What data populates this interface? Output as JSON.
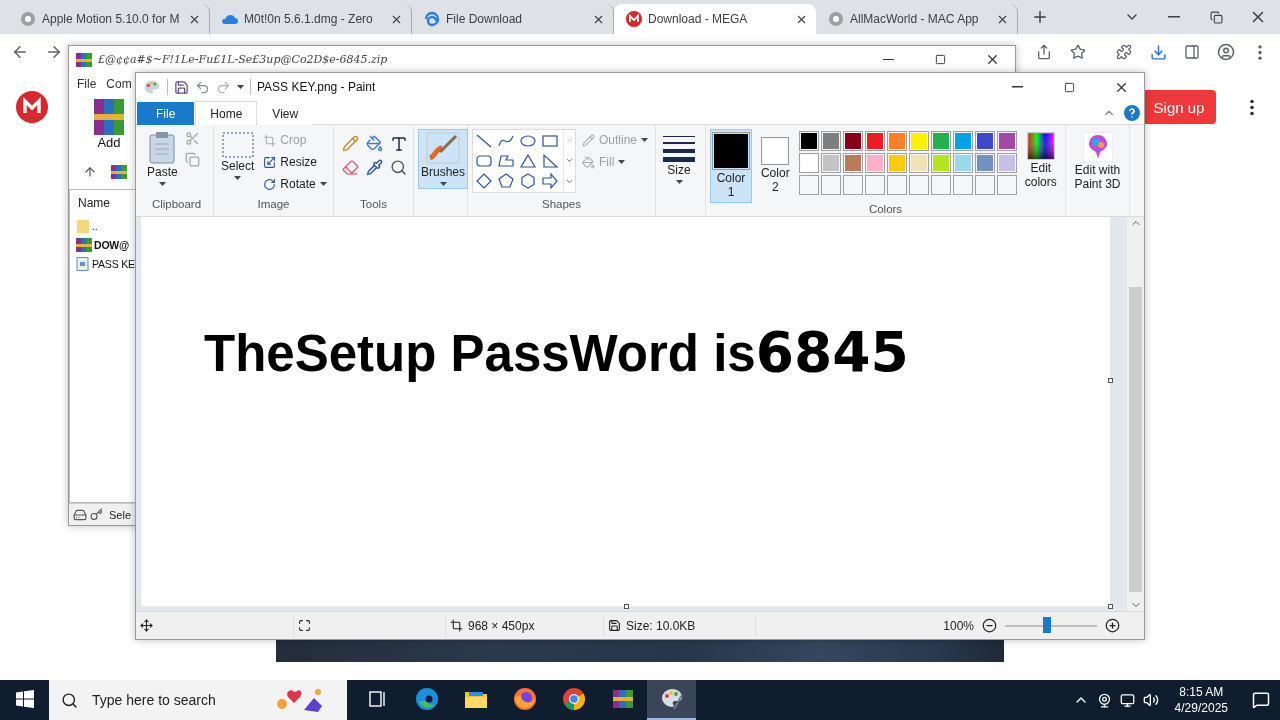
{
  "browser": {
    "tabs": [
      {
        "title": "Apple Motion 5.10.0 for M",
        "kind": "apple",
        "selected": false
      },
      {
        "title": "M0t!0n 5.6.1.dmg - Zero",
        "kind": "cloud",
        "selected": false
      },
      {
        "title": "File Download",
        "kind": "swirl",
        "selected": false
      },
      {
        "title": "Download - MEGA",
        "kind": "mega",
        "selected": true
      },
      {
        "title": "AllMacWorld - MAC App",
        "kind": "apple",
        "selected": false
      }
    ],
    "page": {
      "signup": "Sign up"
    }
  },
  "winrar": {
    "title": "£@¢¢a#$~F!1Le-Fu£1L-Se£3up@Co2D$e-6845.zip",
    "menu": [
      "File",
      "Com"
    ],
    "add": "Add",
    "column": "Name",
    "files": [
      {
        "name": "..",
        "kind": "folder"
      },
      {
        "name": "DOW@",
        "kind": "archive"
      },
      {
        "name": "PASS KE",
        "kind": "image"
      }
    ],
    "status": "Sele"
  },
  "paint": {
    "title": "PASS KEY.png - Paint",
    "tabs": [
      {
        "label": "File",
        "kind": "file",
        "selected": false
      },
      {
        "label": "Home",
        "kind": "tab",
        "selected": true
      },
      {
        "label": "View",
        "kind": "tab",
        "selected": false
      }
    ],
    "clipboard": {
      "paste": "Paste",
      "group": "Clipboard"
    },
    "image": {
      "select": "Select",
      "crop": {
        "label": "Crop",
        "disabled": true
      },
      "resize": {
        "label": "Resize",
        "disabled": false
      },
      "rotate": {
        "label": "Rotate",
        "disabled": false
      },
      "group": "Image"
    },
    "tools": {
      "group": "Tools"
    },
    "brushes": {
      "label": "Brushes",
      "selected": true
    },
    "shapes": {
      "outline": {
        "label": "Outline",
        "disabled": true
      },
      "fill": {
        "label": "Fill",
        "disabled": true
      },
      "group": "Shapes"
    },
    "size": "Size",
    "colors": {
      "color1": {
        "label": "Color 1",
        "color": "#000000",
        "selected": true
      },
      "color2": {
        "label": "Color 2",
        "color": "#ffffff",
        "selected": false
      },
      "palette": [
        {
          "kind": "swatch",
          "color": "#000000"
        },
        {
          "kind": "swatch",
          "color": "#7f7f7f"
        },
        {
          "kind": "swatch",
          "color": "#880015"
        },
        {
          "kind": "swatch",
          "color": "#ed1c24"
        },
        {
          "kind": "swatch",
          "color": "#ff7f27"
        },
        {
          "kind": "swatch",
          "color": "#fff200"
        },
        {
          "kind": "swatch",
          "color": "#22b14c"
        },
        {
          "kind": "swatch",
          "color": "#00a2e8"
        },
        {
          "kind": "swatch",
          "color": "#3f48cc"
        },
        {
          "kind": "swatch",
          "color": "#a349a4"
        },
        {
          "kind": "swatch",
          "color": "#ffffff"
        },
        {
          "kind": "swatch",
          "color": "#c3c3c3"
        },
        {
          "kind": "swatch",
          "color": "#b97a57"
        },
        {
          "kind": "swatch",
          "color": "#ffaec9"
        },
        {
          "kind": "swatch",
          "color": "#ffc90e"
        },
        {
          "kind": "swatch",
          "color": "#efe4b0"
        },
        {
          "kind": "swatch",
          "color": "#b5e61d"
        },
        {
          "kind": "swatch",
          "color": "#99d9ea"
        },
        {
          "kind": "swatch",
          "color": "#7092be"
        },
        {
          "kind": "swatch",
          "color": "#c8bfe7"
        },
        {
          "kind": "empty"
        },
        {
          "kind": "empty"
        },
        {
          "kind": "empty"
        },
        {
          "kind": "empty"
        },
        {
          "kind": "empty"
        },
        {
          "kind": "empty"
        },
        {
          "kind": "empty"
        },
        {
          "kind": "empty"
        },
        {
          "kind": "empty"
        },
        {
          "kind": "empty"
        }
      ],
      "edit": "Edit colors",
      "group": "Colors"
    },
    "paint3d": "Edit with Paint 3D",
    "canvas": {
      "text": "TheSetup PassWord is",
      "number": "6845"
    },
    "status": {
      "dimensions": "968 × 450px",
      "size": "Size: 10.0KB",
      "zoom": "100%",
      "level": 0.46
    }
  },
  "taskbar": {
    "search": {
      "placeholder": "Type here to search"
    },
    "apps": [
      {
        "kind": "taskview",
        "selected": false
      },
      {
        "kind": "edge",
        "selected": false
      },
      {
        "kind": "explorer",
        "selected": false
      },
      {
        "kind": "firefox",
        "selected": false
      },
      {
        "kind": "chrome",
        "selected": false
      },
      {
        "kind": "winrar",
        "selected": false
      },
      {
        "kind": "paint",
        "selected": true
      }
    ],
    "time": "8:15 AM",
    "date": "4/29/2025"
  }
}
